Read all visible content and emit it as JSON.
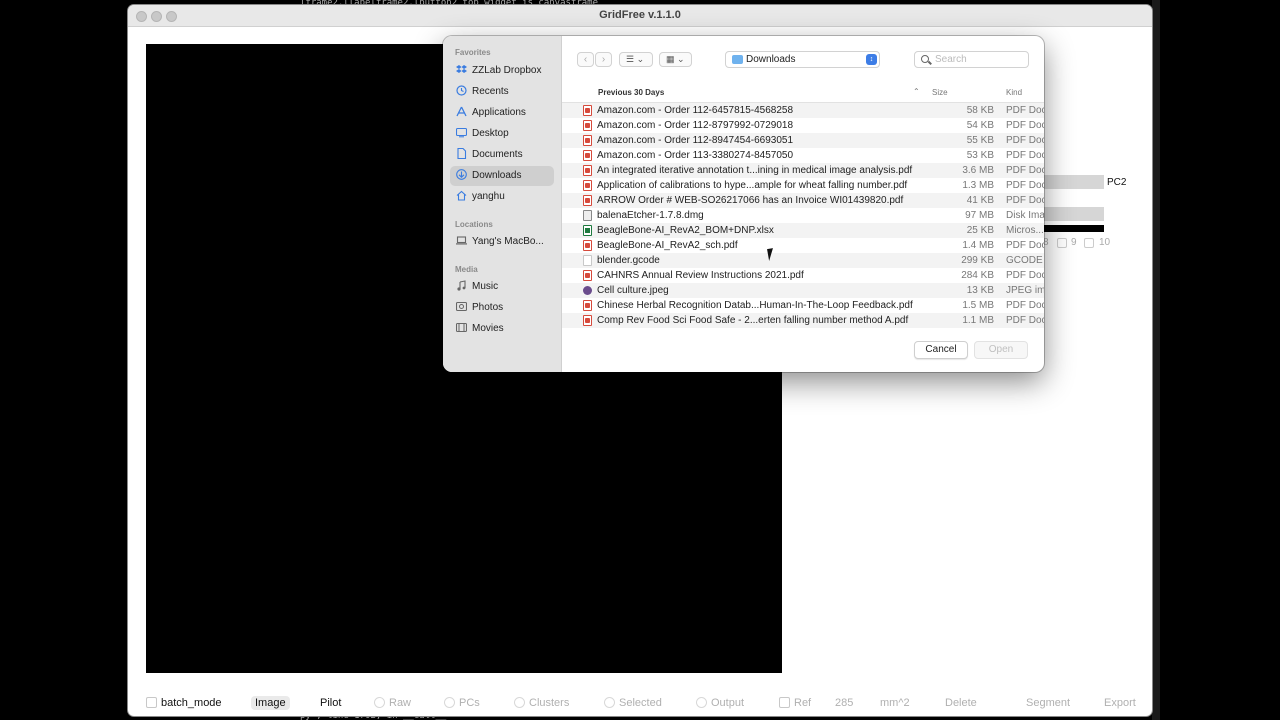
{
  "background": {
    "terminal_top_text": "lframe2.llabelframe2.lbutton2                                                    top widget is canvasframe",
    "terminal_bottom_text": "py\", line 1702, in __call__"
  },
  "app": {
    "title": "GridFree v.1.1.0",
    "right_panel": {
      "pc2_label": "PC2",
      "num_8": "8",
      "num_9": "9",
      "num_10": "10"
    },
    "toolbar": {
      "batch_mode": "batch_mode",
      "image": "Image",
      "pilot": "Pilot",
      "raw": "Raw",
      "pcs": "PCs",
      "clusters": "Clusters",
      "selected": "Selected",
      "output": "Output",
      "ref": "Ref",
      "ref_value": "285",
      "unit": "mm^2",
      "delete": "Delete",
      "segment": "Segment",
      "export": "Export"
    }
  },
  "dialog": {
    "sidebar": {
      "favorites_heading": "Favorites",
      "favorites": [
        {
          "label": "ZZLab Dropbox",
          "icon": "dropbox-icon"
        },
        {
          "label": "Recents",
          "icon": "clock-icon"
        },
        {
          "label": "Applications",
          "icon": "applications-icon"
        },
        {
          "label": "Desktop",
          "icon": "desktop-icon"
        },
        {
          "label": "Documents",
          "icon": "document-icon"
        },
        {
          "label": "Downloads",
          "icon": "download-icon"
        },
        {
          "label": "yanghu",
          "icon": "home-icon"
        }
      ],
      "locations_heading": "Locations",
      "locations": [
        {
          "label": "Yang's MacBo...",
          "icon": "laptop-icon"
        }
      ],
      "media_heading": "Media",
      "media": [
        {
          "label": "Music",
          "icon": "music-icon"
        },
        {
          "label": "Photos",
          "icon": "photos-icon"
        },
        {
          "label": "Movies",
          "icon": "movies-icon"
        }
      ]
    },
    "location": "Downloads",
    "search_placeholder": "Search",
    "columns": {
      "group": "Previous 30 Days",
      "size": "Size",
      "kind": "Kind"
    },
    "files": [
      {
        "name": "Amazon.com - Order 112-6457815-4568258",
        "size": "58 KB",
        "kind": "PDF Doc",
        "type": "pdf"
      },
      {
        "name": "Amazon.com - Order 112-8797992-0729018",
        "size": "54 KB",
        "kind": "PDF Doc",
        "type": "pdf"
      },
      {
        "name": "Amazon.com - Order 112-8947454-6693051",
        "size": "55 KB",
        "kind": "PDF Doc",
        "type": "pdf"
      },
      {
        "name": "Amazon.com - Order 113-3380274-8457050",
        "size": "53 KB",
        "kind": "PDF Doc",
        "type": "pdf"
      },
      {
        "name": "An integrated iterative annotation t...ining in medical image analysis.pdf",
        "size": "3.6 MB",
        "kind": "PDF Doc",
        "type": "pdf"
      },
      {
        "name": "Application of calibrations to hype...ample for wheat falling number.pdf",
        "size": "1.3 MB",
        "kind": "PDF Doc",
        "type": "pdf"
      },
      {
        "name": "ARROW Order # WEB-SO26217066 has an Invoice WI01439820.pdf",
        "size": "41 KB",
        "kind": "PDF Doc",
        "type": "pdf"
      },
      {
        "name": "balenaEtcher-1.7.8.dmg",
        "size": "97 MB",
        "kind": "Disk Ima",
        "type": "dmg"
      },
      {
        "name": "BeagleBone-AI_RevA2_BOM+DNP.xlsx",
        "size": "25 KB",
        "kind": "Micros...",
        "type": "xlsx"
      },
      {
        "name": "BeagleBone-AI_RevA2_sch.pdf",
        "size": "1.4 MB",
        "kind": "PDF Doc",
        "type": "pdf"
      },
      {
        "name": "blender.gcode",
        "size": "299 KB",
        "kind": "GCODE",
        "type": "gcode"
      },
      {
        "name": "CAHNRS Annual Review Instructions 2021.pdf",
        "size": "284 KB",
        "kind": "PDF Doc",
        "type": "pdf"
      },
      {
        "name": "Cell culture.jpeg",
        "size": "13 KB",
        "kind": "JPEG im",
        "type": "jpeg"
      },
      {
        "name": "Chinese Herbal Recognition Datab...Human-In-The-Loop Feedback.pdf",
        "size": "1.5 MB",
        "kind": "PDF Doc",
        "type": "pdf"
      },
      {
        "name": "Comp Rev Food Sci Food Safe - 2...erten falling number method  A.pdf",
        "size": "1.1 MB",
        "kind": "PDF Doc",
        "type": "pdf"
      }
    ],
    "buttons": {
      "cancel": "Cancel",
      "open": "Open"
    }
  }
}
